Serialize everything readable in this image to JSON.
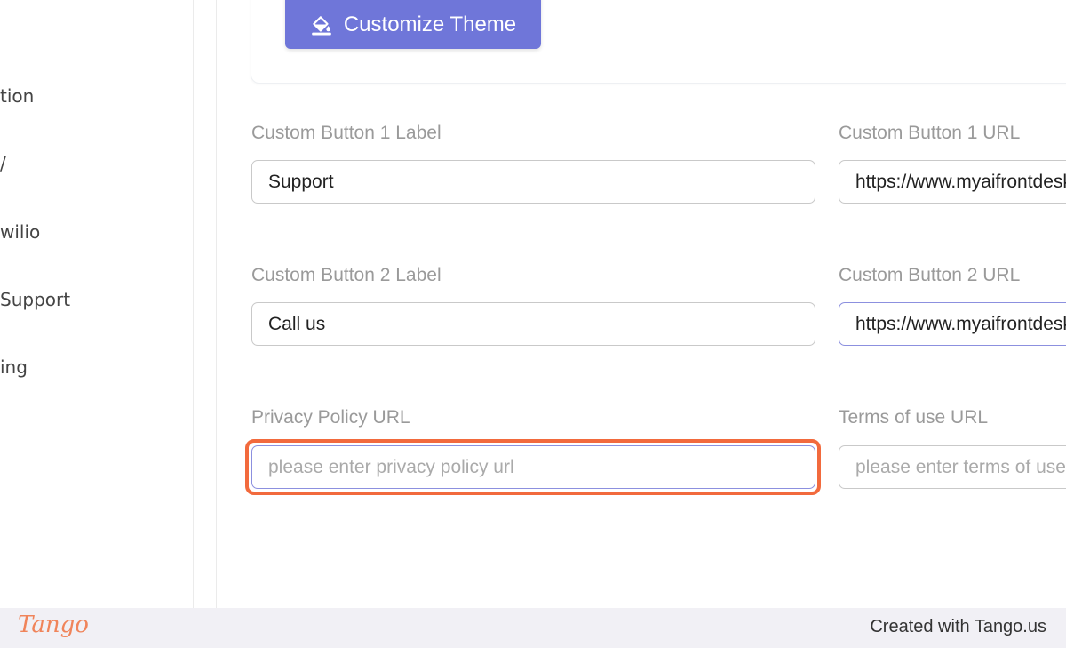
{
  "sidebar": {
    "items": [
      {
        "label": "tion"
      },
      {
        "label": "/"
      },
      {
        "label": "wilio"
      },
      {
        "label": "Support"
      },
      {
        "label": "ing"
      }
    ]
  },
  "theme": {
    "button_label": "Customize Theme",
    "icon": "paint-bucket-icon"
  },
  "form": {
    "button1_label": {
      "label": "Custom Button 1 Label",
      "value": "Support"
    },
    "button1_url": {
      "label": "Custom Button 1 URL",
      "value": "https://www.myaifrontdesk.com"
    },
    "button2_label": {
      "label": "Custom Button 2 Label",
      "value": "Call us"
    },
    "button2_url": {
      "label": "Custom Button 2 URL",
      "value": "https://www.myaifrontdesk.com"
    },
    "privacy_url": {
      "label": "Privacy Policy URL",
      "value": "",
      "placeholder": "please enter privacy policy url"
    },
    "terms_url": {
      "label": "Terms of use URL",
      "value": "",
      "placeholder": "please enter terms of use url"
    }
  },
  "footer": {
    "logo": "Tango",
    "credit": "Created with Tango.us"
  },
  "colors": {
    "accent": "#6f76d9",
    "highlight": "#f26a3d",
    "tango_brand": "#f0845a"
  }
}
